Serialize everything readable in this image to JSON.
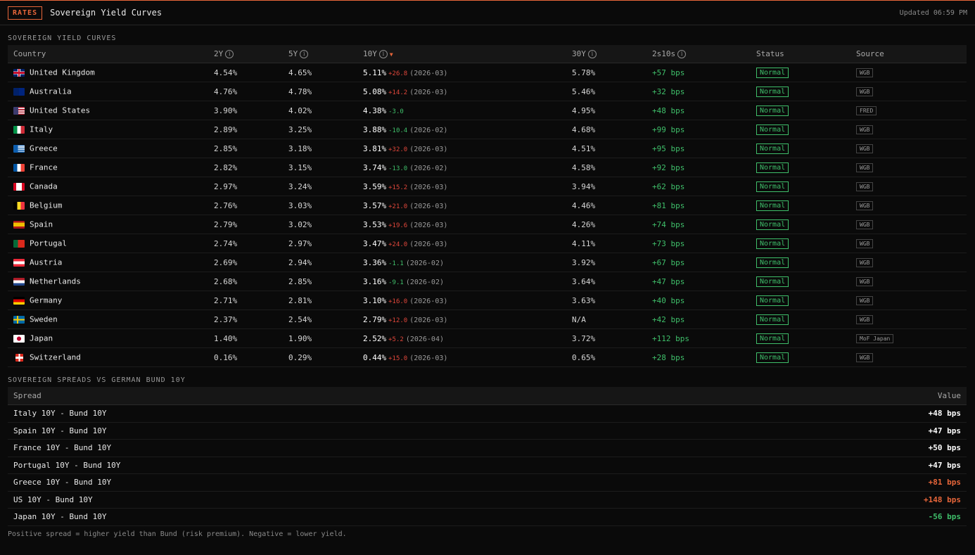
{
  "header": {
    "badge": "RATES",
    "title": "Sovereign Yield Curves",
    "updated": "Updated 06:59 PM"
  },
  "yields": {
    "section_title": "SOVEREIGN YIELD CURVES",
    "columns": {
      "country": "Country",
      "y2": "2Y",
      "y5": "5Y",
      "y10": "10Y",
      "y30": "30Y",
      "s2s10s": "2s10s",
      "status": "Status",
      "source": "Source"
    },
    "rows": [
      {
        "country": "United Kingdom",
        "flag": "gb",
        "y2": "4.54%",
        "y5": "4.65%",
        "y10": "5.11%",
        "chg": "+26.8",
        "dir": "up",
        "date": "(2026-03)",
        "y30": "5.78%",
        "spread": "+57 bps",
        "status": "Normal",
        "source": "WGB"
      },
      {
        "country": "Australia",
        "flag": "au",
        "y2": "4.76%",
        "y5": "4.78%",
        "y10": "5.08%",
        "chg": "+14.2",
        "dir": "up",
        "date": "(2026-03)",
        "y30": "5.46%",
        "spread": "+32 bps",
        "status": "Normal",
        "source": "WGB"
      },
      {
        "country": "United States",
        "flag": "us",
        "y2": "3.90%",
        "y5": "4.02%",
        "y10": "4.38%",
        "chg": "-3.0",
        "dir": "down",
        "date": "",
        "y30": "4.95%",
        "spread": "+48 bps",
        "status": "Normal",
        "source": "FRED"
      },
      {
        "country": "Italy",
        "flag": "it",
        "y2": "2.89%",
        "y5": "3.25%",
        "y10": "3.88%",
        "chg": "-10.4",
        "dir": "down",
        "date": "(2026-02)",
        "y30": "4.68%",
        "spread": "+99 bps",
        "status": "Normal",
        "source": "WGB"
      },
      {
        "country": "Greece",
        "flag": "gr",
        "y2": "2.85%",
        "y5": "3.18%",
        "y10": "3.81%",
        "chg": "+32.0",
        "dir": "up",
        "date": "(2026-03)",
        "y30": "4.51%",
        "spread": "+95 bps",
        "status": "Normal",
        "source": "WGB"
      },
      {
        "country": "France",
        "flag": "fr",
        "y2": "2.82%",
        "y5": "3.15%",
        "y10": "3.74%",
        "chg": "-13.0",
        "dir": "down",
        "date": "(2026-02)",
        "y30": "4.58%",
        "spread": "+92 bps",
        "status": "Normal",
        "source": "WGB"
      },
      {
        "country": "Canada",
        "flag": "ca",
        "y2": "2.97%",
        "y5": "3.24%",
        "y10": "3.59%",
        "chg": "+15.2",
        "dir": "up",
        "date": "(2026-03)",
        "y30": "3.94%",
        "spread": "+62 bps",
        "status": "Normal",
        "source": "WGB"
      },
      {
        "country": "Belgium",
        "flag": "be",
        "y2": "2.76%",
        "y5": "3.03%",
        "y10": "3.57%",
        "chg": "+21.0",
        "dir": "up",
        "date": "(2026-03)",
        "y30": "4.46%",
        "spread": "+81 bps",
        "status": "Normal",
        "source": "WGB"
      },
      {
        "country": "Spain",
        "flag": "es",
        "y2": "2.79%",
        "y5": "3.02%",
        "y10": "3.53%",
        "chg": "+19.6",
        "dir": "up",
        "date": "(2026-03)",
        "y30": "4.26%",
        "spread": "+74 bps",
        "status": "Normal",
        "source": "WGB"
      },
      {
        "country": "Portugal",
        "flag": "pt",
        "y2": "2.74%",
        "y5": "2.97%",
        "y10": "3.47%",
        "chg": "+24.0",
        "dir": "up",
        "date": "(2026-03)",
        "y30": "4.11%",
        "spread": "+73 bps",
        "status": "Normal",
        "source": "WGB"
      },
      {
        "country": "Austria",
        "flag": "at",
        "y2": "2.69%",
        "y5": "2.94%",
        "y10": "3.36%",
        "chg": "-1.1",
        "dir": "down",
        "date": "(2026-02)",
        "y30": "3.92%",
        "spread": "+67 bps",
        "status": "Normal",
        "source": "WGB"
      },
      {
        "country": "Netherlands",
        "flag": "nl",
        "y2": "2.68%",
        "y5": "2.85%",
        "y10": "3.16%",
        "chg": "-9.1",
        "dir": "down",
        "date": "(2026-02)",
        "y30": "3.64%",
        "spread": "+47 bps",
        "status": "Normal",
        "source": "WGB"
      },
      {
        "country": "Germany",
        "flag": "de",
        "y2": "2.71%",
        "y5": "2.81%",
        "y10": "3.10%",
        "chg": "+16.0",
        "dir": "up",
        "date": "(2026-03)",
        "y30": "3.63%",
        "spread": "+40 bps",
        "status": "Normal",
        "source": "WGB"
      },
      {
        "country": "Sweden",
        "flag": "se",
        "y2": "2.37%",
        "y5": "2.54%",
        "y10": "2.79%",
        "chg": "+12.0",
        "dir": "up",
        "date": "(2026-03)",
        "y30": "N/A",
        "spread": "+42 bps",
        "status": "Normal",
        "source": "WGB"
      },
      {
        "country": "Japan",
        "flag": "jp",
        "y2": "1.40%",
        "y5": "1.90%",
        "y10": "2.52%",
        "chg": "+5.2",
        "dir": "up",
        "date": "(2026-04)",
        "y30": "3.72%",
        "spread": "+112 bps",
        "status": "Normal",
        "source": "MoF Japan"
      },
      {
        "country": "Switzerland",
        "flag": "ch",
        "y2": "0.16%",
        "y5": "0.29%",
        "y10": "0.44%",
        "chg": "+15.0",
        "dir": "up",
        "date": "(2026-03)",
        "y30": "0.65%",
        "spread": "+28 bps",
        "status": "Normal",
        "source": "WGB"
      }
    ]
  },
  "spreads": {
    "section_title": "SOVEREIGN SPREADS VS GERMAN BUND 10Y",
    "columns": {
      "spread": "Spread",
      "value": "Value"
    },
    "rows": [
      {
        "label": "Italy 10Y - Bund 10Y",
        "value": "+48 bps",
        "tone": "white"
      },
      {
        "label": "Spain 10Y - Bund 10Y",
        "value": "+47 bps",
        "tone": "white"
      },
      {
        "label": "France 10Y - Bund 10Y",
        "value": "+50 bps",
        "tone": "white"
      },
      {
        "label": "Portugal 10Y - Bund 10Y",
        "value": "+47 bps",
        "tone": "white"
      },
      {
        "label": "Greece 10Y - Bund 10Y",
        "value": "+81 bps",
        "tone": "orange"
      },
      {
        "label": "US 10Y - Bund 10Y",
        "value": "+148 bps",
        "tone": "orange"
      },
      {
        "label": "Japan 10Y - Bund 10Y",
        "value": "-56 bps",
        "tone": "green"
      }
    ],
    "footnote": "Positive spread = higher yield than Bund (risk premium). Negative = lower yield."
  },
  "colors": {
    "accent": "#e8663a",
    "positive": "#3fbf6a",
    "negative": "#e0473b"
  }
}
